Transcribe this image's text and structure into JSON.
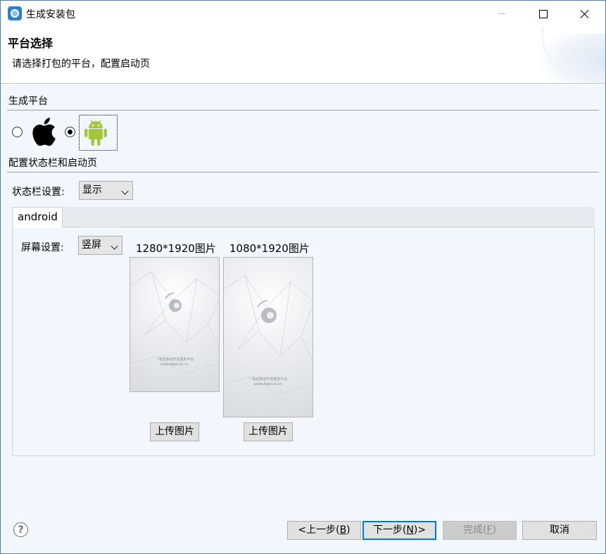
{
  "window": {
    "title": "生成安装包"
  },
  "header": {
    "title": "平台选择",
    "description": "请选择打包的平台，配置启动页"
  },
  "platform_section": {
    "label": "生成平台",
    "options": [
      {
        "name": "ios",
        "icon": "apple-icon",
        "selected": false
      },
      {
        "name": "android",
        "icon": "android-icon",
        "selected": true
      }
    ]
  },
  "config_section": {
    "label": "配置状态栏和启动页",
    "status_bar_label": "状态栏设置:",
    "status_bar_value": "显示"
  },
  "tabs": [
    {
      "label": "android",
      "active": true
    }
  ],
  "android_tab": {
    "screen_label": "屏幕设置:",
    "screen_value": "竖屏",
    "images": [
      {
        "label": "1280*1920图片",
        "upload_label": "上传图片",
        "caption_line1": "一站式移动开发服务平台",
        "caption_line2": "www.AppCan.cn"
      },
      {
        "label": "1080*1920图片",
        "upload_label": "上传图片",
        "caption_line1": "一站式移动开发服务平台",
        "caption_line2": "www.AppCan.cn"
      }
    ]
  },
  "footer": {
    "help_symbol": "?",
    "back_label": "<上一步(",
    "back_key": "B",
    "back_suffix": ")",
    "next_label": "下一步(",
    "next_key": "N",
    "next_suffix": ")>",
    "finish_label": "完成(",
    "finish_key": "F",
    "finish_suffix": ")",
    "cancel_label": "取消"
  },
  "colors": {
    "window_bg": "#f1f7fc",
    "accent": "#0078d7",
    "android_green": "#a4c639"
  }
}
